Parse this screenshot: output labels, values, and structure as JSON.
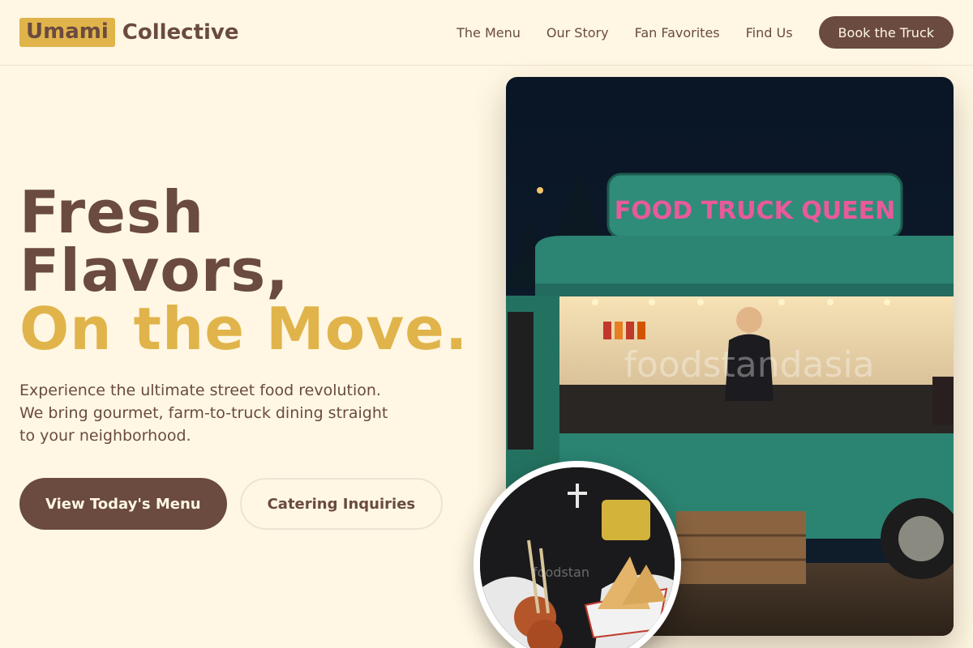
{
  "brand": {
    "badge": "Umami",
    "name": "Collective"
  },
  "nav": {
    "links": [
      "The Menu",
      "Our Story",
      "Fan Favorites",
      "Find Us"
    ],
    "cta": "Book the Truck"
  },
  "hero": {
    "line1": "Fresh",
    "line2": "Flavors,",
    "line3": "On the Move.",
    "description": "Experience the ultimate street food revolution. We bring gourmet, farm-to-truck dining straight to your neighborhood.",
    "primary_button": "View Today's Menu",
    "secondary_button": "Catering Inquiries"
  },
  "photo": {
    "truck_sign": "FOOD TRUCK QUEEN",
    "watermark": "foodstandasia",
    "small_watermark": "foodstan"
  },
  "colors": {
    "brown": "#6b4a40",
    "gold": "#e0b44b",
    "cream": "#fff7e3"
  }
}
